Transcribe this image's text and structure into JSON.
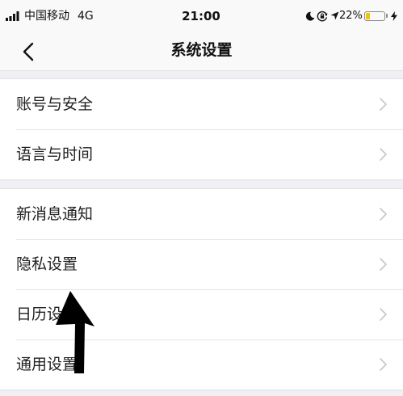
{
  "status_bar": {
    "carrier": "中国移动",
    "network": "4G",
    "time": "21:00",
    "battery_text": "22%",
    "battery_level": 0.22,
    "icons": [
      "signal-bars-icon",
      "moon-icon",
      "rotation-lock-icon",
      "location-arrow-icon",
      "battery-icon",
      "charging-bolt-icon"
    ]
  },
  "nav": {
    "back_icon": "chevron-left-icon",
    "title": "系统设置"
  },
  "groups": [
    {
      "items": [
        {
          "label": "账号与安全",
          "icon": "chevron-right-icon"
        },
        {
          "label": "语言与时间",
          "icon": "chevron-right-icon"
        }
      ]
    },
    {
      "items": [
        {
          "label": "新消息通知",
          "icon": "chevron-right-icon"
        },
        {
          "label": "隐私设置",
          "icon": "chevron-right-icon"
        },
        {
          "label": "日历设置",
          "icon": "chevron-right-icon"
        },
        {
          "label": "通用设置",
          "icon": "chevron-right-icon"
        }
      ]
    }
  ],
  "colors": {
    "background": "#efeff4",
    "row_background": "#ffffff",
    "text": "#222222",
    "chevron": "#c7c7cc",
    "battery_fill": "#f5c400",
    "annotation_arrow": "#000000"
  }
}
